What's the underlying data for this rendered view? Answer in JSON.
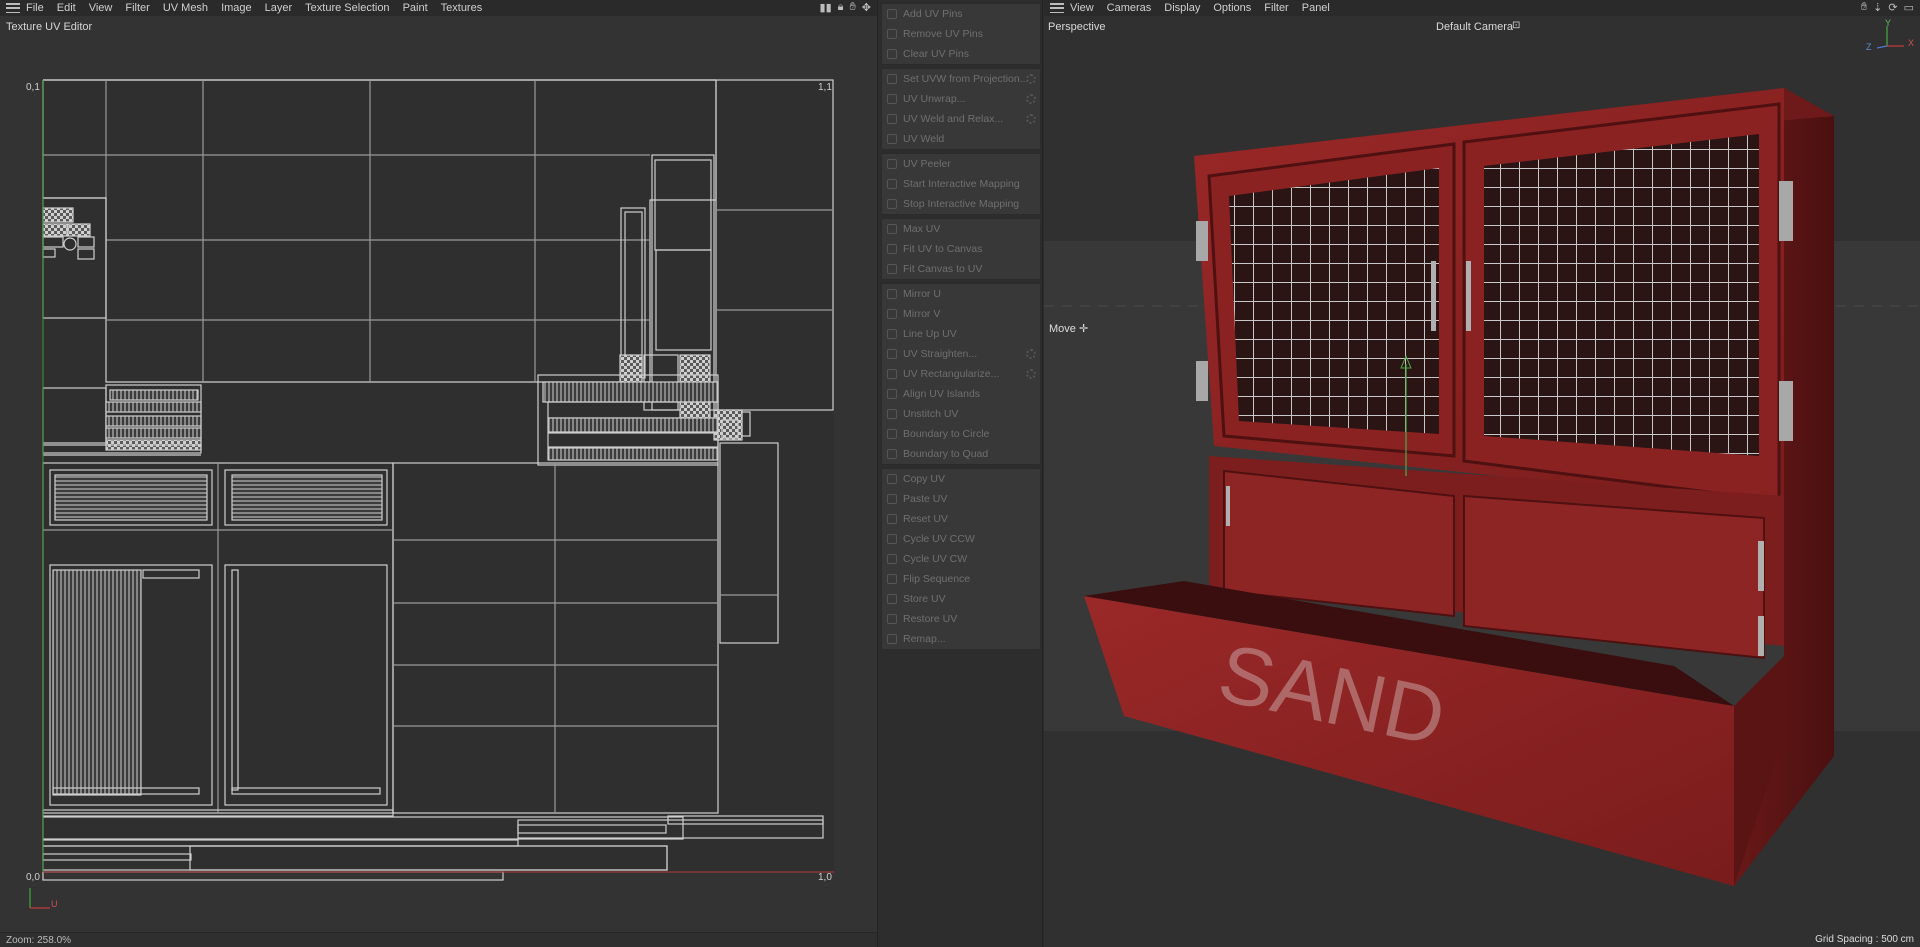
{
  "uv_editor": {
    "menu": [
      "File",
      "Edit",
      "View",
      "Filter",
      "UV Mesh",
      "Image",
      "Layer",
      "Texture Selection",
      "Paint",
      "Textures"
    ],
    "title": "Texture UV Editor",
    "corner_tl": "0,1",
    "corner_tr": "1,1",
    "corner_bl": "0,0",
    "corner_br": "1,0",
    "axis_u": "U",
    "zoom": "Zoom: 258.0%"
  },
  "commands": {
    "groups": [
      [
        {
          "label": "Add UV Pins",
          "gear": false
        },
        {
          "label": "Remove UV Pins",
          "gear": false
        },
        {
          "label": "Clear UV Pins",
          "gear": false
        }
      ],
      [
        {
          "label": "Set UVW from Projection...",
          "gear": true
        },
        {
          "label": "UV Unwrap...",
          "gear": true
        },
        {
          "label": "UV Weld and Relax...",
          "gear": true
        },
        {
          "label": "UV Weld",
          "gear": false
        }
      ],
      [
        {
          "label": "UV Peeler",
          "gear": false
        },
        {
          "label": "Start Interactive Mapping",
          "gear": false
        },
        {
          "label": "Stop Interactive Mapping",
          "gear": false
        }
      ],
      [
        {
          "label": "Max UV",
          "gear": false
        },
        {
          "label": "Fit UV to Canvas",
          "gear": false
        },
        {
          "label": "Fit Canvas to UV",
          "gear": false
        }
      ],
      [
        {
          "label": "Mirror U",
          "gear": false
        },
        {
          "label": "Mirror V",
          "gear": false
        },
        {
          "label": "Line Up UV",
          "gear": false
        },
        {
          "label": "UV Straighten...",
          "gear": true
        },
        {
          "label": "UV Rectangularize...",
          "gear": true
        },
        {
          "label": "Align UV Islands",
          "gear": false
        },
        {
          "label": "Unstitch UV",
          "gear": false
        },
        {
          "label": "Boundary to Circle",
          "gear": false
        },
        {
          "label": "Boundary to Quad",
          "gear": false
        }
      ],
      [
        {
          "label": "Copy UV",
          "gear": false
        },
        {
          "label": "Paste UV",
          "gear": false
        },
        {
          "label": "Reset UV",
          "gear": false
        },
        {
          "label": "Cycle UV CCW",
          "gear": false
        },
        {
          "label": "Cycle UV CW",
          "gear": false
        },
        {
          "label": "Flip Sequence",
          "gear": false
        },
        {
          "label": "Store UV",
          "gear": false
        },
        {
          "label": "Restore UV",
          "gear": false
        },
        {
          "label": "Remap...",
          "gear": false
        }
      ]
    ]
  },
  "viewport": {
    "menu": [
      "View",
      "Cameras",
      "Display",
      "Options",
      "Filter",
      "Panel"
    ],
    "projection": "Perspective",
    "camera": "Default Camera",
    "tool": "Move",
    "grid_spacing": "Grid Spacing : 500 cm",
    "axis_x": "X",
    "axis_y": "Y",
    "axis_z": "Z",
    "sign_text": "SAND",
    "colors": {
      "crate_red": "#8e2222",
      "crate_dark": "#5e1515",
      "metal": "#b5b5b5"
    }
  }
}
